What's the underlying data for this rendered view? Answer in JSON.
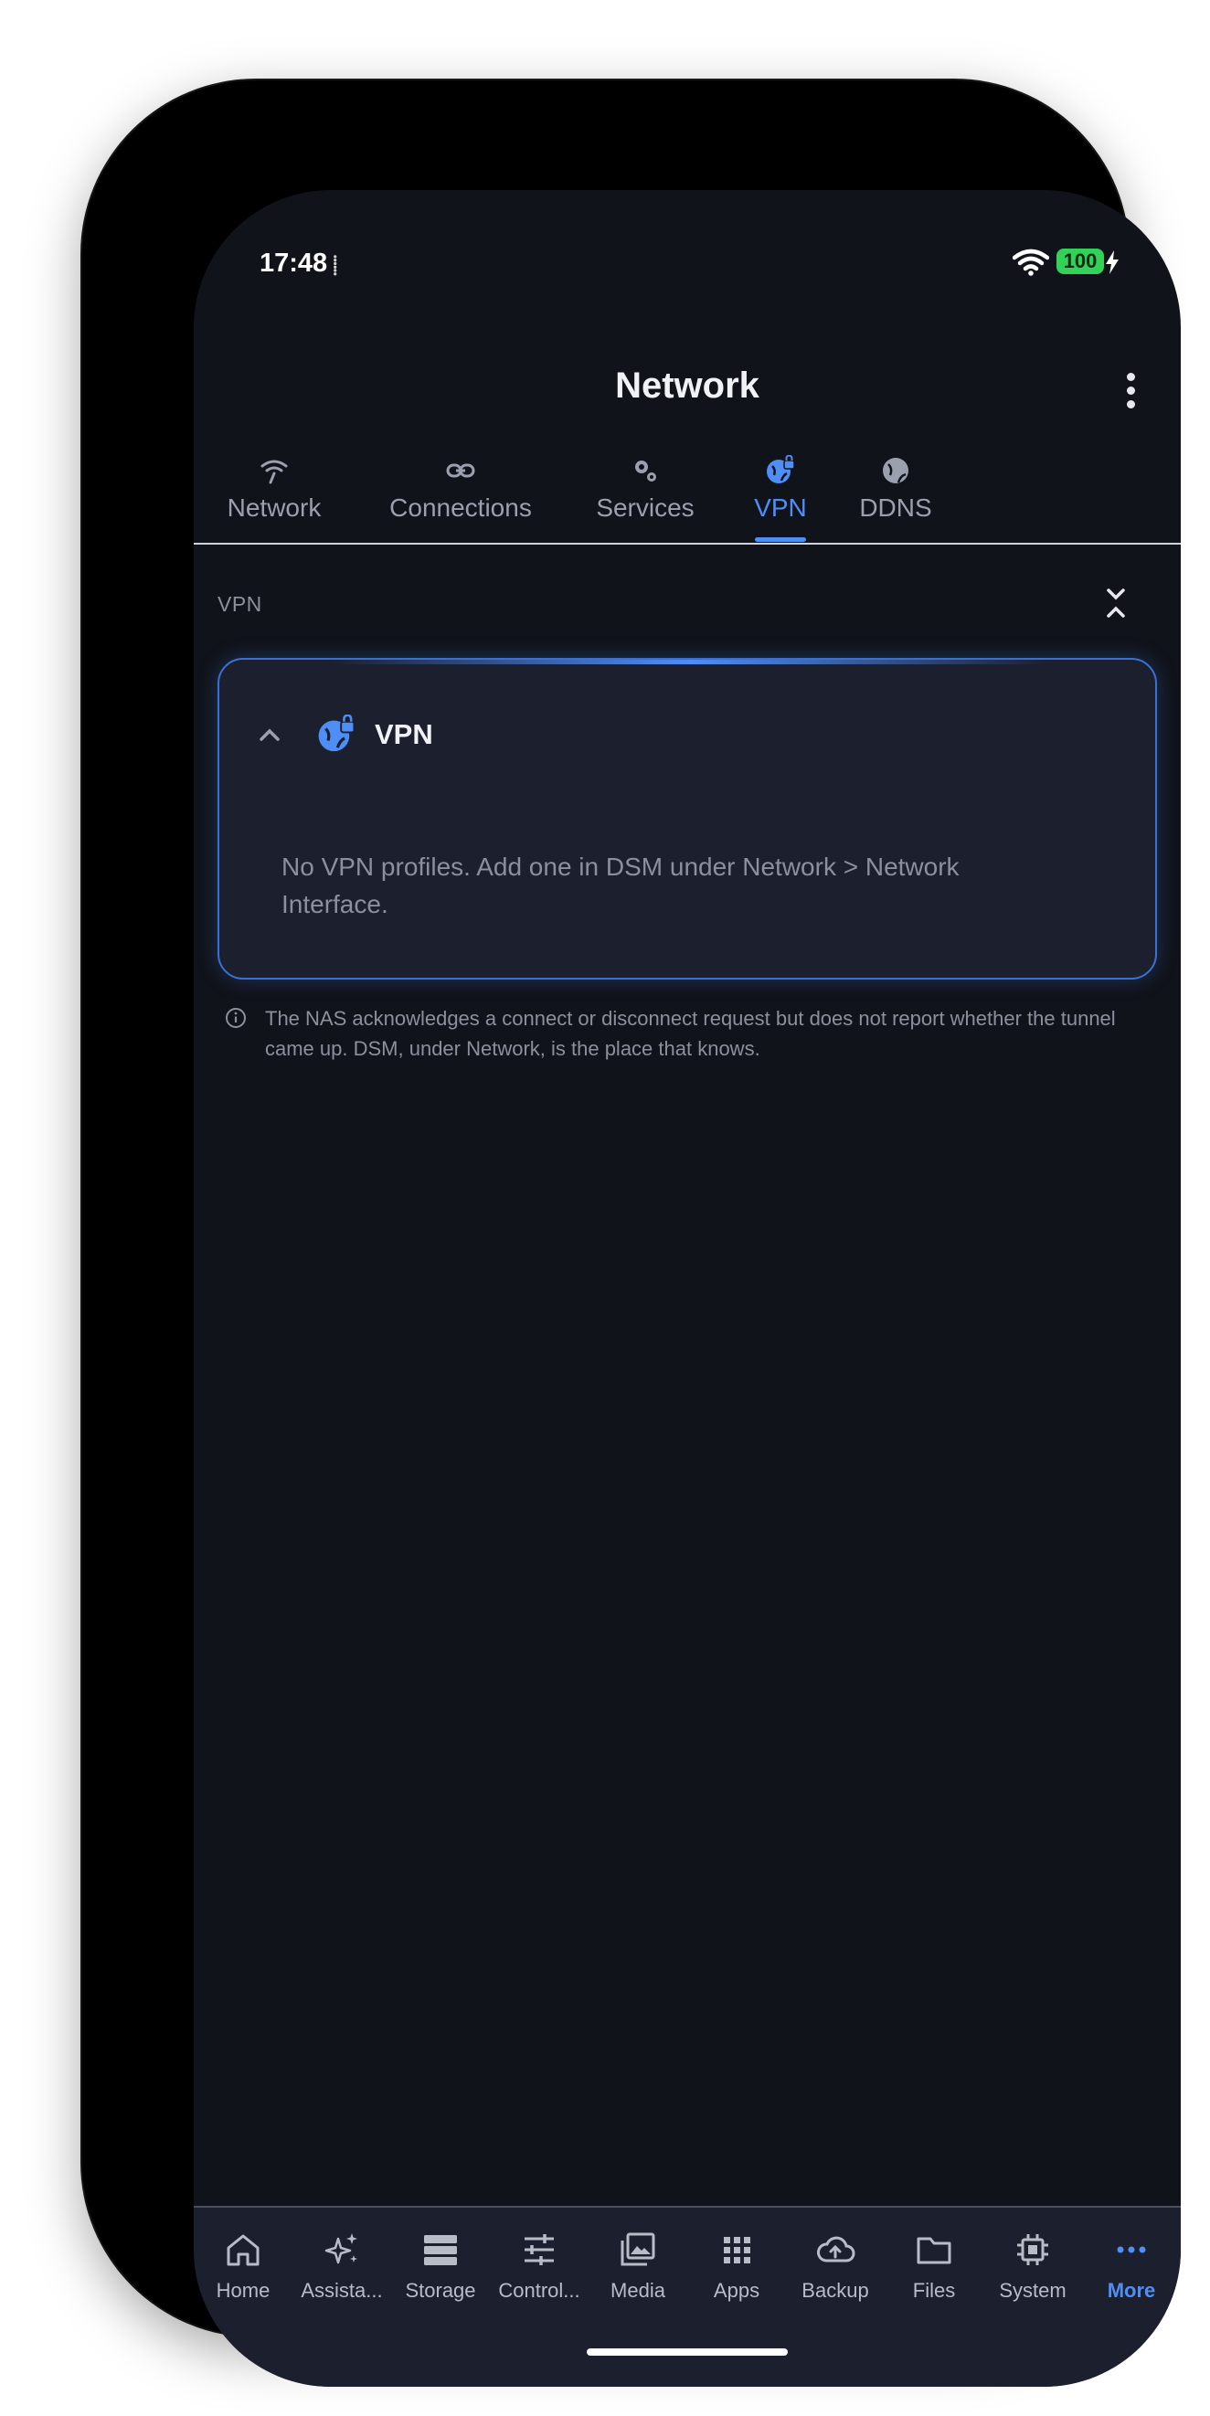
{
  "status_bar": {
    "time": "17:48",
    "extra_indicator": "⸽",
    "battery": "100"
  },
  "app_bar": {
    "title": "Network",
    "menu_icon": "more-vertical-icon"
  },
  "tabs": [
    {
      "label": "Network",
      "icon": "router-icon",
      "active": false
    },
    {
      "label": "Connections",
      "icon": "link-icon",
      "active": false
    },
    {
      "label": "Services",
      "icon": "gears-icon",
      "active": false
    },
    {
      "label": "VPN",
      "icon": "globe-lock-icon",
      "active": true
    },
    {
      "label": "DDNS",
      "icon": "globe-icon",
      "active": false
    }
  ],
  "section": {
    "label": "VPN",
    "collapse_icon": "collapse-all-icon"
  },
  "card": {
    "title": "VPN",
    "empty_message": "No VPN profiles. Add one in DSM under Network > Network Interface."
  },
  "info_note": "The NAS acknowledges a connect or disconnect request but does not report whether the tunnel came up. DSM, under Network, is the place that knows.",
  "bottom_nav": [
    {
      "label": "Home",
      "icon": "home-icon",
      "active": false
    },
    {
      "label": "Assista...",
      "icon": "sparkle-icon",
      "active": false
    },
    {
      "label": "Storage",
      "icon": "storage-icon",
      "active": false
    },
    {
      "label": "Control...",
      "icon": "sliders-icon",
      "active": false
    },
    {
      "label": "Media",
      "icon": "photos-icon",
      "active": false
    },
    {
      "label": "Apps",
      "icon": "apps-grid-icon",
      "active": false
    },
    {
      "label": "Backup",
      "icon": "cloud-upload-icon",
      "active": false
    },
    {
      "label": "Files",
      "icon": "folder-icon",
      "active": false
    },
    {
      "label": "System",
      "icon": "chip-icon",
      "active": false
    },
    {
      "label": "More",
      "icon": "more-horizontal-icon",
      "active": true
    }
  ],
  "colors": {
    "accent": "#4f8ef7",
    "background": "#11131a",
    "card": "#1b1f2e",
    "battery": "#32d158"
  }
}
